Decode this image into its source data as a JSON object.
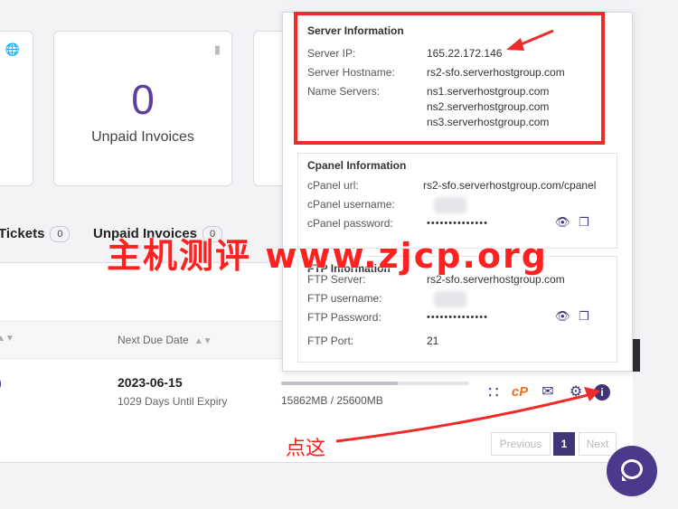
{
  "stats": {
    "unpaid_invoices_count": "0",
    "unpaid_invoices_label": "Unpaid Invoices"
  },
  "tabs": [
    {
      "label": "Tickets",
      "count": "0"
    },
    {
      "label": "Unpaid Invoices",
      "count": "0"
    }
  ],
  "table": {
    "column_next_due": "Next Due Date",
    "row": {
      "due_date": "2023-06-15",
      "days_until_expiry": "1029 Days Until Expiry",
      "usage_text": "15862MB / 25600MB",
      "usage_fraction": 0.62
    }
  },
  "pagination": {
    "previous": "Previous",
    "page": "1",
    "next": "Next"
  },
  "popover": {
    "server": {
      "title": "Server Information",
      "ip_label": "Server IP:",
      "ip": "165.22.172.146",
      "hostname_label": "Server Hostname:",
      "hostname": "rs2-sfo.serverhostgroup.com",
      "ns_label": "Name Servers:",
      "ns1": "ns1.serverhostgroup.com",
      "ns2": "ns2.serverhostgroup.com",
      "ns3": "ns3.serverhostgroup.com"
    },
    "cpanel": {
      "title": "Cpanel Information",
      "url_label": "cPanel url:",
      "url": "rs2-sfo.serverhostgroup.com/cpanel",
      "username_label": "cPanel username:",
      "password_label": "cPanel password:",
      "password_masked": "••••••••••••••"
    },
    "ftp": {
      "title": "FTP Information",
      "server_label": "FTP Server:",
      "server": "rs2-sfo.serverhostgroup.com",
      "username_label": "FTP username:",
      "password_label": "FTP Password:",
      "password_masked": "••••••••••••••",
      "port_label": "FTP Port:",
      "port": "21"
    }
  },
  "overlay": {
    "watermark": "主机测评 www.zjcp.org",
    "click_here": "点这"
  },
  "colors": {
    "accent": "#3f3577",
    "stat_number": "#5a3fa0",
    "annotation_red": "#ef2a2a",
    "cpanel_orange": "#f26c21"
  }
}
